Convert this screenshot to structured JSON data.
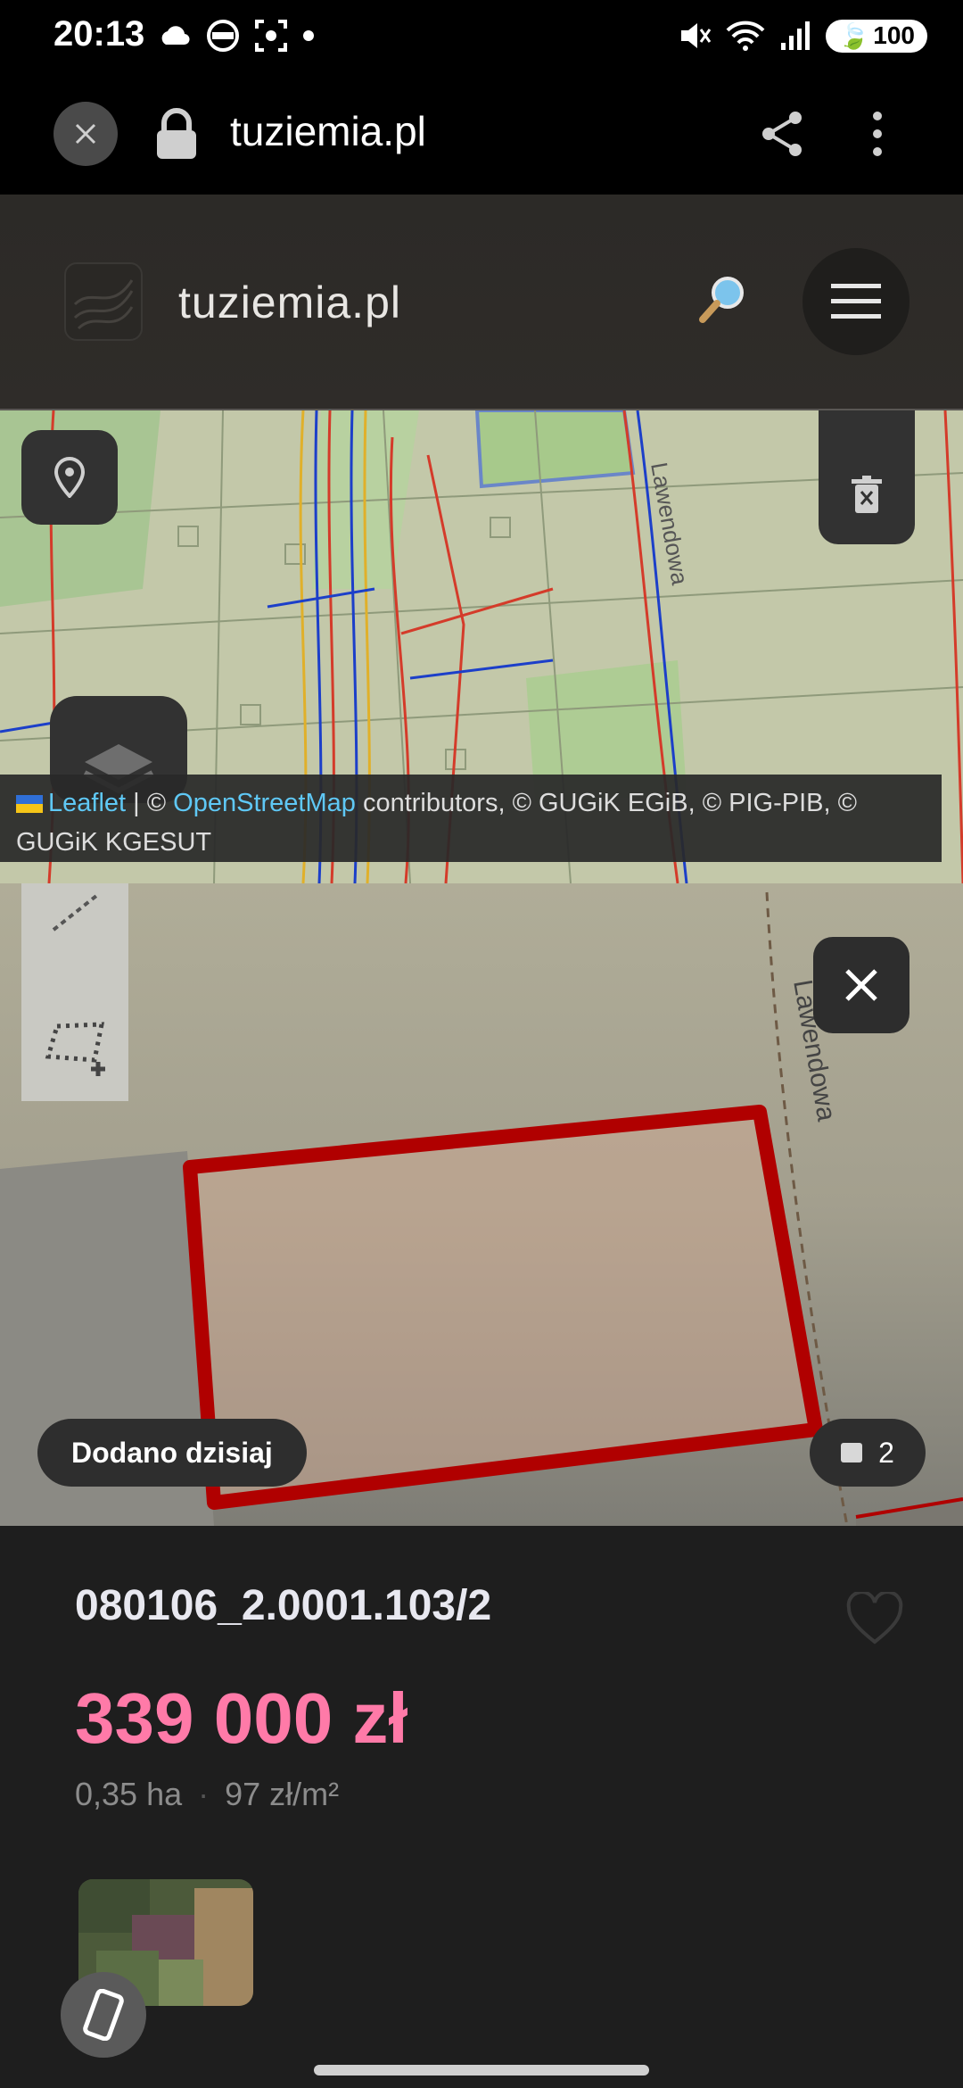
{
  "status_bar": {
    "time": "20:13",
    "battery": "100",
    "icons": [
      "cloud-icon",
      "steering-wheel-icon",
      "scan-icon",
      "dot-icon",
      "mute-icon",
      "wifi-icon",
      "signal-icon"
    ]
  },
  "browser": {
    "url": "tuziemia.pl"
  },
  "site": {
    "title": "tuziemia.pl"
  },
  "map_top": {
    "street_label": "Lawendowa",
    "attribution": {
      "leaflet": "Leaflet",
      "sep": " | © ",
      "osm": "OpenStreetMap",
      "rest": " contributors, © GUGiK EGiB, © PIG-PIB, © GUGiK KGESUT"
    }
  },
  "map_parcel": {
    "street_label": "Lawendowa",
    "added_badge": "Dodano dzisiaj",
    "photo_count": "2"
  },
  "listing": {
    "parcel_id": "080106_2.0001.103/2",
    "price": "339 000 zł",
    "area": "0,35 ha",
    "separator": "·",
    "price_per_m2": "97 zł/m²"
  },
  "colors": {
    "price": "#ff7aa8",
    "parcel_outline": "#b00000",
    "link": "#5fc8f5"
  }
}
